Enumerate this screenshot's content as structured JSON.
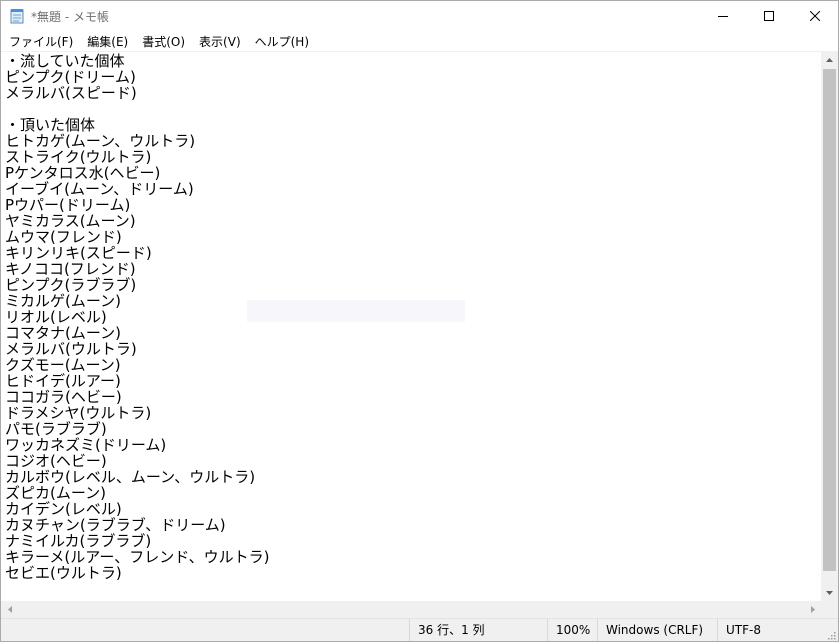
{
  "window": {
    "title": "*無題 - メモ帳",
    "minimize_icon": "minimize-icon",
    "maximize_icon": "maximize-icon",
    "close_icon": "close-icon"
  },
  "menu": {
    "items": [
      {
        "label": "ファイル(F)"
      },
      {
        "label": "編集(E)"
      },
      {
        "label": "書式(O)"
      },
      {
        "label": "表示(V)"
      },
      {
        "label": "ヘルプ(H)"
      }
    ]
  },
  "editor": {
    "content": "・流していた個体\nピンプク(ドリーム)\nメラルバ(スピード)\n\n・頂いた個体\nヒトカゲ(ムーン、ウルトラ)\nストライク(ウルトラ)\nPケンタロス水(ヘビー)\nイーブイ(ムーン、ドリーム)\nPウパー(ドリーム)\nヤミカラス(ムーン)\nムウマ(フレンド)\nキリンリキ(スピード)\nキノココ(フレンド)\nピンプク(ラブラブ)\nミカルゲ(ムーン)\nリオル(レベル)\nコマタナ(ムーン)\nメラルバ(ウルトラ)\nクズモー(ムーン)\nヒドイデ(ルアー)\nココガラ(ヘビー)\nドラメシヤ(ウルトラ)\nパモ(ラブラブ)\nワッカネズミ(ドリーム)\nコジオ(ヘビー)\nカルボウ(レベル、ムーン、ウルトラ)\nズピカ(ムーン)\nカイデン(レベル)\nカヌチャン(ラブラブ、ドリーム)\nナミイルカ(ラブラブ)\nキラーメ(ルアー、フレンド、ウルトラ)\nセビエ(ウルトラ)"
  },
  "statusbar": {
    "position": "36 行、1 列",
    "zoom": "100%",
    "line_ending": "Windows (CRLF)",
    "encoding": "UTF-8"
  },
  "colors": {
    "chrome_bg": "#f0f0f0",
    "scroll_thumb": "#c2c2c2",
    "title_text": "#6d6d6d"
  }
}
